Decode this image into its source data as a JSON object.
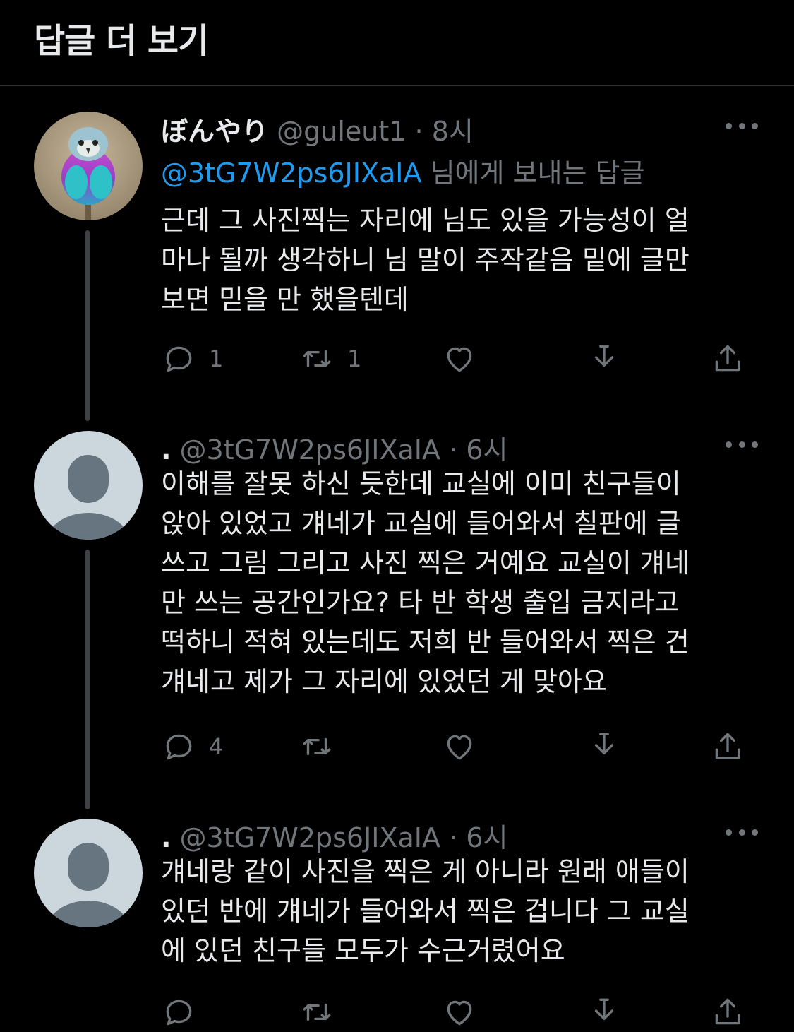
{
  "header": {
    "title": "답글 더 보기"
  },
  "tweets": [
    {
      "display_name": "ぼんやり",
      "handle": "@guleut1",
      "sep": "·",
      "time": "8시",
      "reply_to_mention": "@3tG7W2ps6JIXaIA",
      "reply_to_suffix": "님에게 보내는 답글",
      "lines": [
        "근데 그 사진찍는 자리에 님도 있을 가능성이 얼",
        "마나 될까 생각하니 님 말이 주작같음 밑에 글만",
        "보면 믿을 만 했을텐데"
      ],
      "reply_count": "1",
      "retweet_count": "1",
      "like_count": ""
    },
    {
      "display_name": ".",
      "handle": "@3tG7W2ps6JIXaIA",
      "sep": "·",
      "time": "6시",
      "lines": [
        "이해를 잘못 하신 듯한데 교실에 이미 친구들이",
        "앉아 있었고 걔네가 교실에 들어와서 칠판에 글",
        "쓰고 그림 그리고 사진 찍은 거예요 교실이 걔네",
        "만 쓰는 공간인가요? 타 반 학생 출입 금지라고",
        "떡하니 적혀 있는데도 저희 반 들어와서 찍은 건",
        "걔네고 제가 그 자리에 있었던 게 맞아요"
      ],
      "reply_count": "4",
      "retweet_count": "",
      "like_count": ""
    },
    {
      "display_name": ".",
      "handle": "@3tG7W2ps6JIXaIA",
      "sep": "·",
      "time": "6시",
      "lines": [
        "걔네랑 같이 사진을 찍은 게 아니라 원래 애들이",
        "있던 반에 걔네가 들어와서 찍은 겁니다 그 교실",
        "에 있던 친구들 모두가 수근거렸어요"
      ],
      "reply_count": "",
      "retweet_count": "",
      "like_count": ""
    }
  ],
  "icons": {
    "reply": "reply-icon",
    "retweet": "retweet-icon",
    "like": "heart-icon",
    "download": "download-icon",
    "share": "share-icon",
    "more": "more-icon"
  },
  "colors": {
    "background": "#000000",
    "text": "#e7e9ea",
    "muted": "#71767b",
    "mention": "#1d9bf0",
    "thread_line": "#3e4144"
  }
}
